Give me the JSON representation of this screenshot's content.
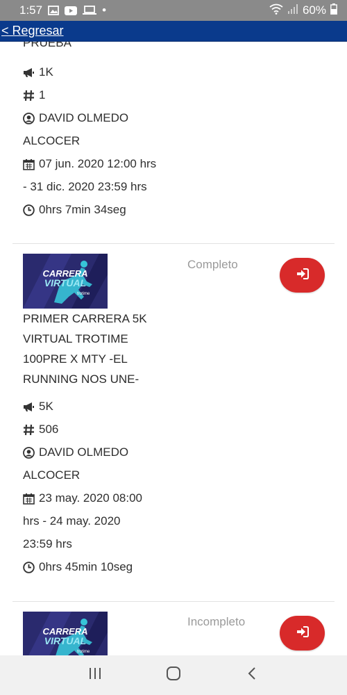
{
  "status_bar": {
    "time": "1:57",
    "dot": "•",
    "battery": "60%",
    "icons": [
      "image-icon",
      "youtube-icon",
      "laptop-icon",
      "wifi-icon",
      "signal-icon",
      "battery-icon"
    ]
  },
  "nav": {
    "back_label": "< Regresar"
  },
  "colors": {
    "nav_bg": "#0a3a8c",
    "status_bg": "#8a8a8a",
    "button_red": "#d82a2a"
  },
  "race1": {
    "title_tail": "PRUEBA",
    "distance": "1K",
    "number": "1",
    "runner_line1": "DAVID OLMEDO",
    "runner_line2": "ALCOCER",
    "date_line1": "07 jun. 2020 12:00 hrs",
    "date_line2": "- 31 dic. 2020 23:59 hrs",
    "time": "0hrs 7min 34seg"
  },
  "race2": {
    "status": "Completo",
    "title_lines": [
      "PRIMER CARRERA 5K",
      "VIRTUAL TROTIME",
      "100PRE X MTY -EL",
      "RUNNING NOS UNE-"
    ],
    "distance": "5K",
    "number": "506",
    "runner_line1": "DAVID OLMEDO",
    "runner_line2": "ALCOCER",
    "date_line1": "23 may. 2020 08:00",
    "date_line2": "hrs - 24 may. 2020",
    "date_line3": "23:59 hrs",
    "time": "0hrs 45min 10seg"
  },
  "race3": {
    "status": "Incompleto"
  },
  "thumbnail": {
    "line1": "CARRERA",
    "line2": "VIRTUAL",
    "brand": "trotime"
  }
}
